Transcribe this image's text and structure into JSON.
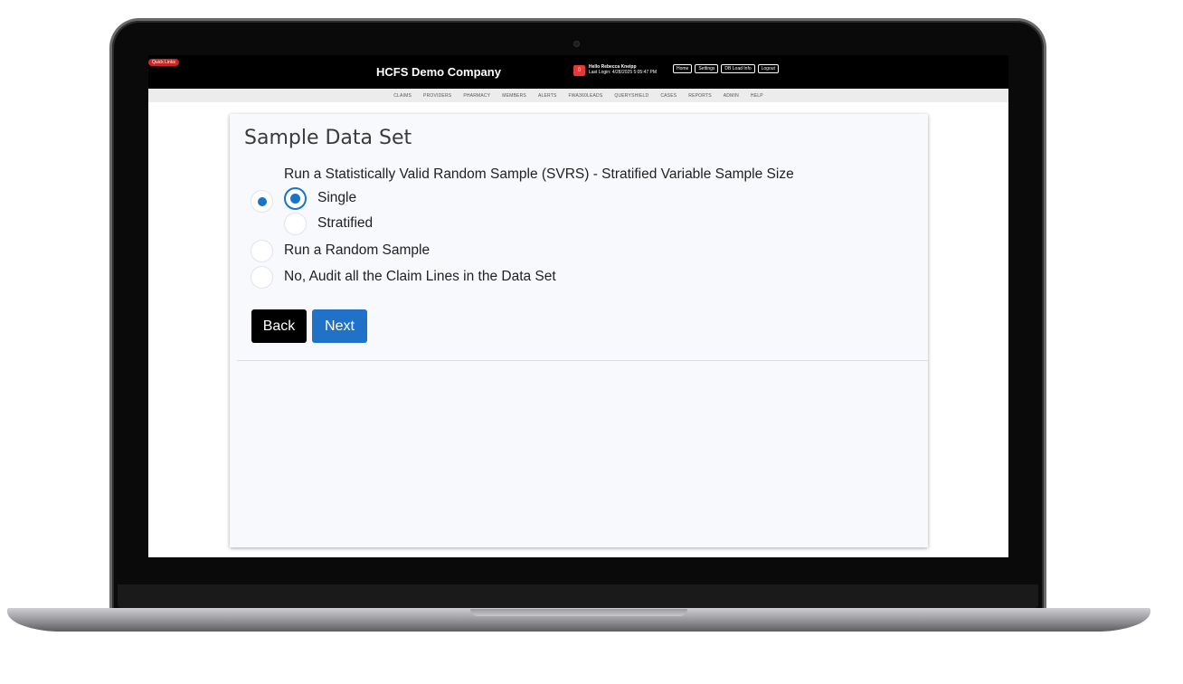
{
  "app": {
    "quick_links": "Quick Links",
    "company": "HCFS Demo Company",
    "notification_count": "0",
    "greeting": "Hello Rebecca Kneipp",
    "last_login": "Last Login: 4/28/2025 5:05:47 PM",
    "top_buttons": [
      "Home",
      "Settings",
      "DB Load Info",
      "Logout"
    ]
  },
  "nav": [
    "CLAIMS",
    "PROVIDERS",
    "PHARMACY",
    "MEMBERS",
    "ALERTS",
    "FWA360LEADS",
    "QUERYSHIELD",
    "CASES",
    "REPORTS",
    "ADMIN",
    "HELP"
  ],
  "form": {
    "title": "Sample Data Set",
    "svrs_label": "Run a Statistically Valid Random Sample (SVRS) - Stratified Variable Sample Size",
    "single_label": "Single",
    "stratified_label": "Stratified",
    "random_label": "Run a Random Sample",
    "audit_all_label": "No, Audit all the Claim Lines in the Data Set",
    "selected_option": "svrs",
    "selected_sub_option": "single",
    "back_label": "Back",
    "next_label": "Next"
  },
  "colors": {
    "accent": "#1f72c7",
    "topbar": "#000000",
    "navbar": "#ececec"
  }
}
